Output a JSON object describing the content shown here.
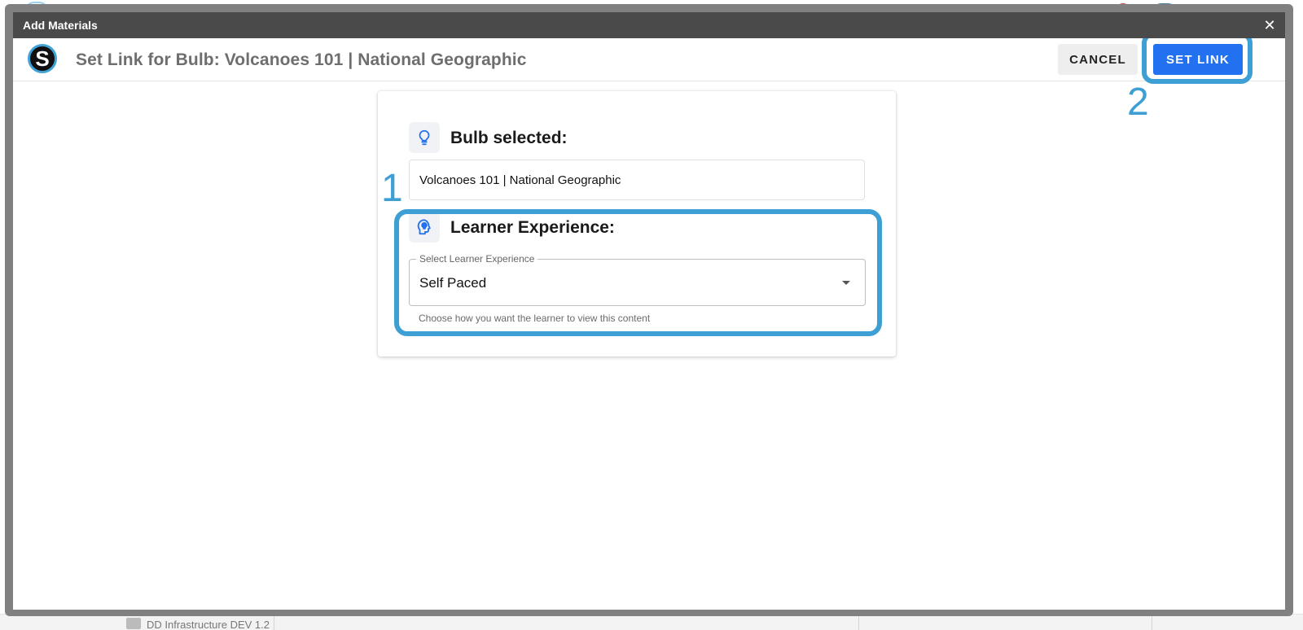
{
  "modal": {
    "title": "Add Materials",
    "close_glyph": "✕"
  },
  "header": {
    "logo_letter": "S",
    "title": "Set Link for Bulb: Volcanoes 101 | National Geographic",
    "cancel_label": "CANCEL",
    "set_link_label": "SET LINK"
  },
  "bulb_section": {
    "heading": "Bulb selected:",
    "icon": "lightbulb-icon",
    "value": "Volcanoes 101 | National Geographic"
  },
  "learner_section": {
    "heading": "Learner Experience:",
    "icon": "head-lightbulb-icon",
    "select_label": "Select Learner Experience",
    "selected_value": "Self Paced",
    "helper_text": "Choose how you want the learner to view this content"
  },
  "annotations": {
    "step_1": "1",
    "step_2": "2",
    "highlight_color": "#3d9fd3"
  },
  "background": {
    "bottom_row_text": "DD Infrastructure DEV 1.2"
  },
  "colors": {
    "primary_button": "#2271f0",
    "icon_blue": "#2271f0",
    "titlebar": "#4a4a4a",
    "modal_frame": "#808080"
  }
}
